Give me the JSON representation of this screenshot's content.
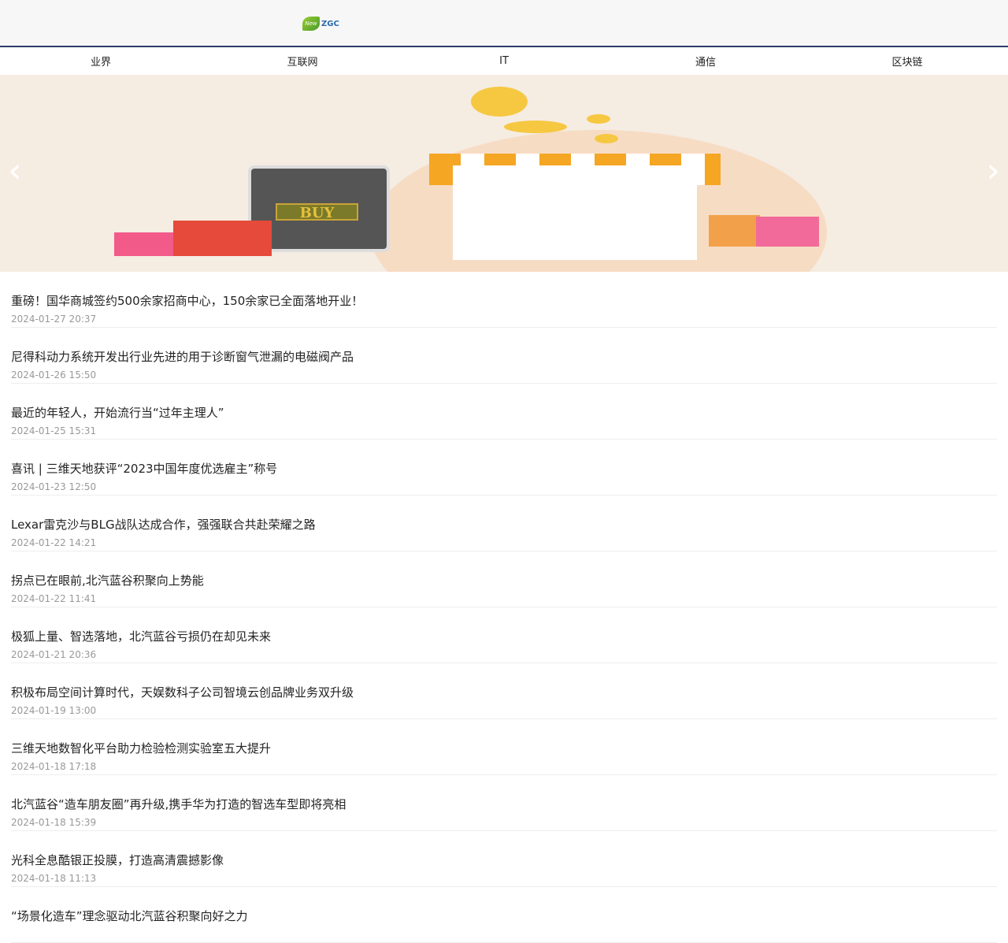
{
  "header": {
    "logo_text": "ZGC"
  },
  "nav": [
    "业界",
    "互联网",
    "IT",
    "通信",
    "区块链"
  ],
  "banner": {
    "buy_label": "BUY",
    "prev": "‹",
    "next": "›"
  },
  "articles": [
    {
      "title": "重磅！国华商城签约500余家招商中心，150余家已全面落地开业！",
      "date": "2024-01-27 20:37"
    },
    {
      "title": "尼得科动力系统开发出行业先进的用于诊断窗气泄漏的电磁阀产品",
      "date": "2024-01-26 15:50"
    },
    {
      "title": "最近的年轻人，开始流行当“过年主理人”",
      "date": "2024-01-25 15:31"
    },
    {
      "title": "喜讯 | 三维天地获评“2023中国年度优选雇主”称号",
      "date": "2024-01-23 12:50"
    },
    {
      "title": "Lexar雷克沙与BLG战队达成合作，强强联合共赴荣耀之路",
      "date": "2024-01-22 14:21"
    },
    {
      "title": "拐点已在眼前,北汽蓝谷积聚向上势能",
      "date": "2024-01-22 11:41"
    },
    {
      "title": "极狐上量、智选落地，北汽蓝谷亏损仍在却见未来",
      "date": "2024-01-21 20:36"
    },
    {
      "title": "积极布局空间计算时代，天娱数科子公司智境云创品牌业务双升级",
      "date": "2024-01-19 13:00"
    },
    {
      "title": "三维天地数智化平台助力检验检测实验室五大提升",
      "date": "2024-01-18 17:18"
    },
    {
      "title": "北汽蓝谷“造车朋友圈”再升级,携手华为打造的智选车型即将亮相",
      "date": "2024-01-18 15:39"
    },
    {
      "title": "光科全息酷银正投膜，打造高清震撼影像",
      "date": "2024-01-18 11:13"
    },
    {
      "title": "“场景化造车”理念驱动北汽蓝谷积聚向好之力",
      "date": ""
    }
  ]
}
